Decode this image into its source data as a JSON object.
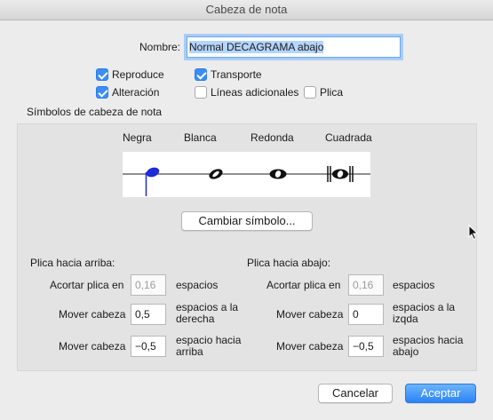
{
  "window": {
    "title": "Cabeza de nota"
  },
  "name": {
    "label": "Nombre:",
    "value": "Normal DECAGRAMA abajo"
  },
  "checkboxes": [
    {
      "label": "Reproduce",
      "checked": true
    },
    {
      "label": "Transporte",
      "checked": true
    },
    {
      "label": "Alteración",
      "checked": true
    },
    {
      "label": "Líneas adicionales",
      "checked": false
    },
    {
      "label": "Plica",
      "checked": false
    }
  ],
  "symbols": {
    "section_label": "Símbolos de cabeza de nota",
    "headers": [
      "Negra",
      "Blanca",
      "Redonda",
      "Cuadrada"
    ],
    "selected": "Negra",
    "selection_color": "#1f2bd6",
    "change_button": "Cambiar símbolo..."
  },
  "stem_up": {
    "title": "Plica hacia arriba:",
    "rows": [
      {
        "label": "Acortar plica en",
        "value": "0,16",
        "unit": "espacios",
        "disabled": true
      },
      {
        "label": "Mover cabeza",
        "value": "0,5",
        "unit": "espacios a la derecha",
        "disabled": false
      },
      {
        "label": "Mover cabeza",
        "value": "−0,5",
        "unit": "espacio hacia arriba",
        "disabled": false
      }
    ]
  },
  "stem_down": {
    "title": "Plica hacia abajo:",
    "rows": [
      {
        "label": "Acortar plica en",
        "value": "0,16",
        "unit": "espacios",
        "disabled": true
      },
      {
        "label": "Mover cabeza",
        "value": "0",
        "unit": "espacios a la izqda",
        "disabled": false
      },
      {
        "label": "Mover cabeza",
        "value": "−0,5",
        "unit": "espacios hacia abajo",
        "disabled": false
      }
    ]
  },
  "buttons": {
    "cancel": "Cancelar",
    "ok": "Aceptar"
  }
}
